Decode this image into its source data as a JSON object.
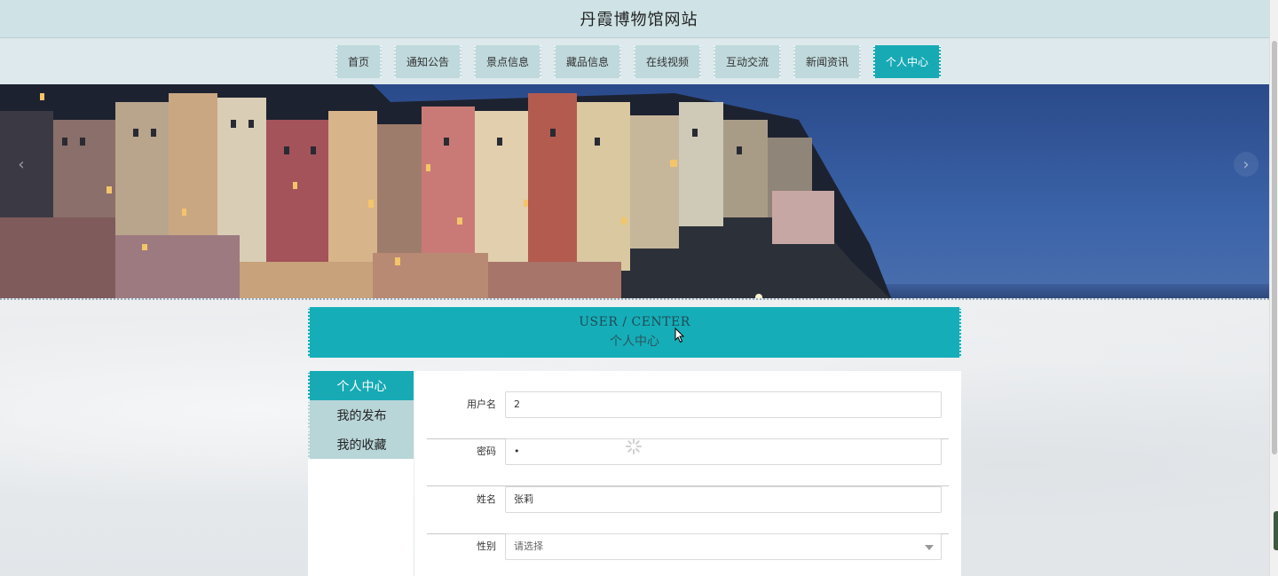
{
  "header": {
    "title": "丹霞博物馆网站"
  },
  "nav": {
    "items": [
      {
        "label": "首页",
        "active": false
      },
      {
        "label": "通知公告",
        "active": false
      },
      {
        "label": "景点信息",
        "active": false
      },
      {
        "label": "藏品信息",
        "active": false
      },
      {
        "label": "在线视频",
        "active": false
      },
      {
        "label": "互动交流",
        "active": false
      },
      {
        "label": "新闻资讯",
        "active": false
      },
      {
        "label": "个人中心",
        "active": true
      }
    ]
  },
  "banner": {
    "image": "coastal-village-night-photo",
    "prev_icon": "chevron-left-icon",
    "next_icon": "chevron-right-icon"
  },
  "section": {
    "title_en": "USER / CENTER",
    "title_cn": "个人中心"
  },
  "sidebar": {
    "items": [
      {
        "label": "个人中心",
        "active": true
      },
      {
        "label": "我的发布",
        "active": false
      },
      {
        "label": "我的收藏",
        "active": false
      }
    ]
  },
  "form": {
    "username_label": "用户名",
    "username_value": "2",
    "password_label": "密码",
    "password_value": "•",
    "name_label": "姓名",
    "name_value": "张莉",
    "gender_label": "性别",
    "gender_value": "请选择"
  },
  "colors": {
    "accent": "#17aab5",
    "header_bg": "#cfe3e6",
    "nav_item_bg": "#bfd9dc"
  }
}
